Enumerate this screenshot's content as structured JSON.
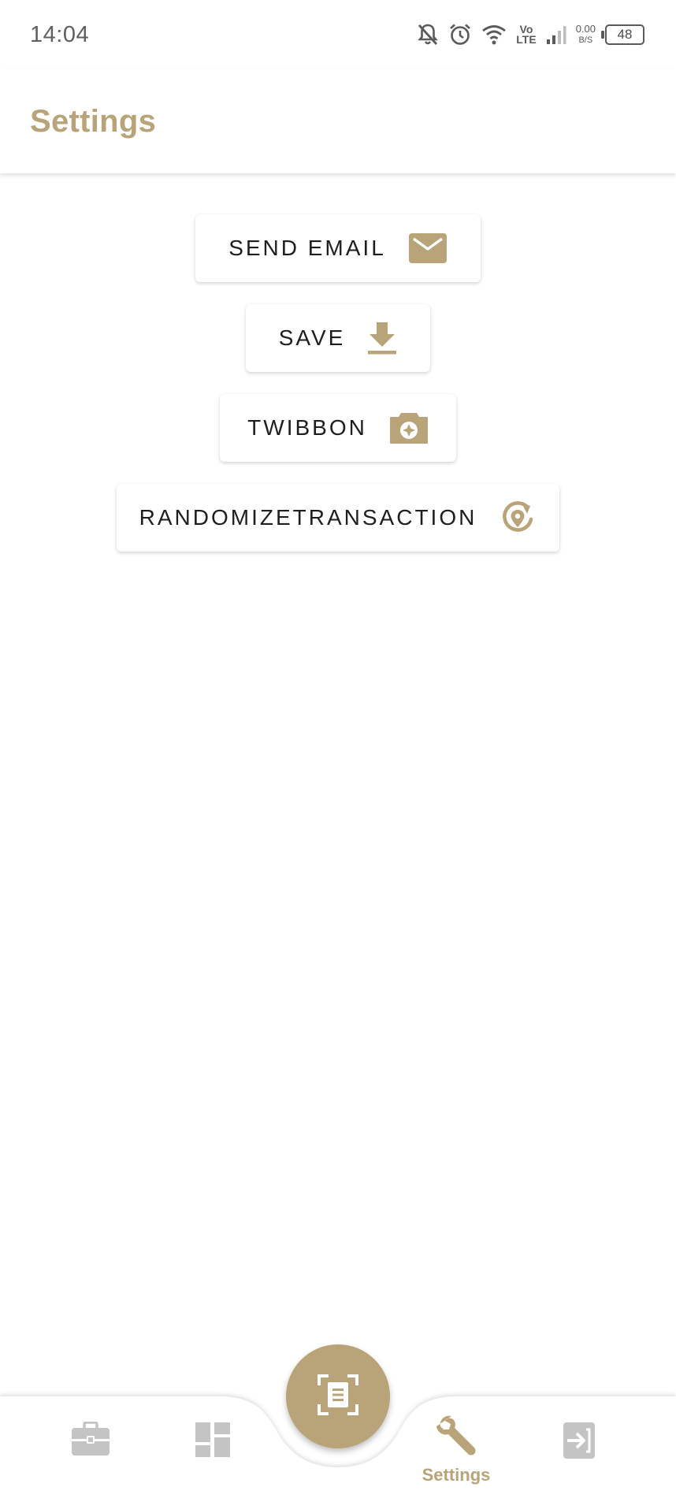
{
  "status_bar": {
    "time": "14:04",
    "volte_top": "Vo",
    "volte_bottom": "LTE",
    "net_speed": "0.00",
    "net_unit": "B/S",
    "battery": "48",
    "icons": [
      "bell-off-icon",
      "alarm-icon",
      "wifi-icon",
      "volte-icon",
      "signal-icon",
      "battery-icon"
    ]
  },
  "app_bar": {
    "title": "Settings"
  },
  "actions": [
    {
      "label": "SEND EMAIL",
      "icon": "mail-icon"
    },
    {
      "label": "SAVE",
      "icon": "download-icon"
    },
    {
      "label": "TWIBBON",
      "icon": "camera-icon"
    },
    {
      "label": "RANDOMIZETRANSACTION",
      "icon": "randomize-icon"
    }
  ],
  "bottom_nav": {
    "items": [
      {
        "icon": "briefcase-icon",
        "label": ""
      },
      {
        "icon": "dashboard-icon",
        "label": ""
      },
      {
        "icon": "wrench-icon",
        "label": "Settings",
        "active": true
      },
      {
        "icon": "login-icon",
        "label": ""
      }
    ],
    "fab_icon": "scan-document-icon"
  },
  "colors": {
    "accent": "#b9a378",
    "inactive_icon": "#c4c4c4",
    "text_dark": "#1e1e1e",
    "status_text": "#5f5f5f"
  }
}
